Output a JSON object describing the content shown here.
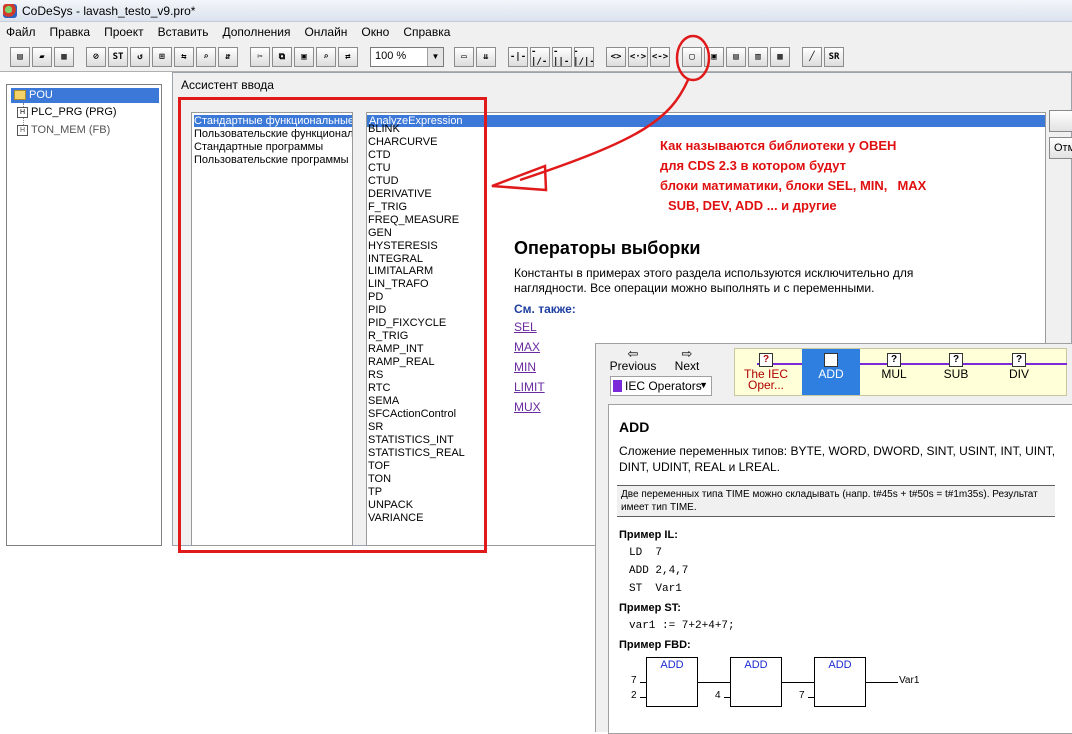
{
  "window": {
    "title": "CoDeSys - lavash_testo_v9.pro*"
  },
  "menu": [
    "Файл",
    "Правка",
    "Проект",
    "Вставить",
    "Дополнения",
    "Онлайн",
    "Окно",
    "Справка"
  ],
  "toolbar": {
    "zoom_value": "100 %",
    "button_glyphs": [
      "▤",
      "▰",
      "▦",
      "⊘",
      "ST",
      "↺",
      "⊞",
      "⇆",
      "⌕",
      "⇵",
      "✂",
      "⧉",
      "▣",
      "⌕",
      "⇄",
      "▭",
      "⇊",
      "-|-",
      "-|/-",
      "-||-",
      "-|/|-",
      "<>",
      "<·>",
      "<->",
      "▢",
      "▣",
      "▤",
      "▥",
      "▦",
      "╱",
      "SR"
    ]
  },
  "pou_tree": {
    "root": "POU",
    "items": [
      "PLC_PRG (PRG)",
      "TON_MEM (FB)"
    ]
  },
  "dialog": {
    "title": "Ассистент ввода",
    "categories": [
      "Стандартные функциональные",
      "Пользовательские функциональные",
      "Стандартные программы",
      "Пользовательские программы"
    ],
    "selected_category": 0,
    "functions": [
      "AnalyzeExpression",
      "BLINK",
      "CHARCURVE",
      "CTD",
      "CTU",
      "CTUD",
      "DERIVATIVE",
      "F_TRIG",
      "FREQ_MEASURE",
      "GEN",
      "HYSTERESIS",
      "INTEGRAL",
      "LIMITALARM",
      "LIN_TRAFO",
      "PD",
      "PID",
      "PID_FIXCYCLE",
      "R_TRIG",
      "RAMP_INT",
      "RAMP_REAL",
      "RS",
      "RTC",
      "SEMA",
      "SFCActionControl",
      "SR",
      "STATISTICS_INT",
      "STATISTICS_REAL",
      "TOF",
      "TON",
      "TP",
      "UNPACK",
      "VARIANCE"
    ],
    "selected_function": 0,
    "cancel_label": "Отмена"
  },
  "help": {
    "heading": "Операторы выборки",
    "text": "Константы в примерах этого раздела используются исключительно для наглядности. Все операции можно выполнять и с переменными.",
    "see_also": "См. также:",
    "links": [
      "SEL",
      "MAX",
      "MIN",
      "LIMIT",
      "MUX"
    ]
  },
  "annotation": {
    "lines": [
      "Как называются библиотеки у ОВЕН",
      "для CDS 2.3 в котором будут",
      "блоки матиматики, блоки SEL, MIN,",
      "SUB, DEV, ADD ... и другие"
    ],
    "extra": "MAX",
    "color": "#e01010"
  },
  "help_window": {
    "nav": {
      "previous": "Previous",
      "next": "Next"
    },
    "topic_select": "IEC Operators",
    "breadcrumbs": [
      "The IEC Oper...",
      "ADD",
      "MUL",
      "SUB",
      "DIV"
    ],
    "active_breadcrumb": 1,
    "content": {
      "title": "ADD",
      "description": "Сложение переменных типов: BYTE, WORD, DWORD, SINT, USINT, INT, UINT, DINT, UDINT, REAL и LREAL.",
      "note": "Две переменных типа TIME можно складывать (напр. t#45s + t#50s = t#1m35s). Результат имеет тип TIME.",
      "il_heading": "Пример IL:",
      "il_code": [
        "LD  7",
        "ADD 2,4,7",
        "ST  Var1"
      ],
      "st_heading": "Пример ST:",
      "st_code": "var1 := 7+2+4+7;",
      "fbd_heading": "Пример FBD:",
      "fbd": {
        "block_label": "ADD",
        "inputs": [
          "7",
          "2",
          "4",
          "7"
        ],
        "output": "Var1"
      }
    }
  }
}
